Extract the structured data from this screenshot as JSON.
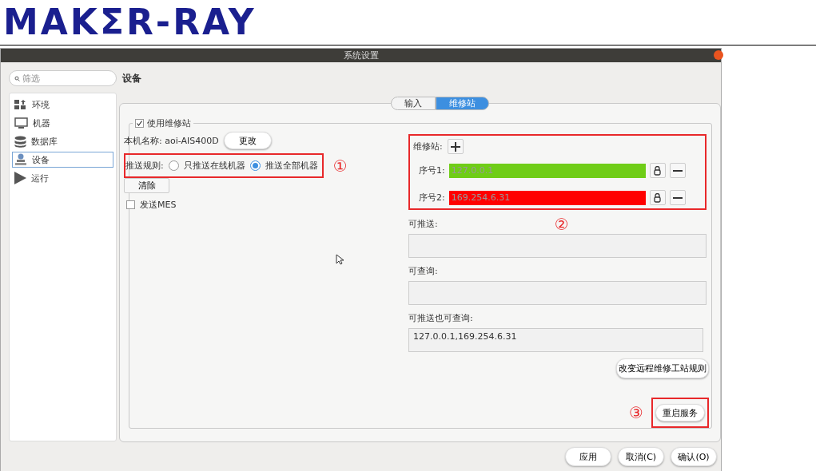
{
  "logo": "MAKΣR-RAY",
  "window": {
    "title": "系统设置"
  },
  "sidebar": {
    "filter_placeholder": "筛选",
    "items": [
      {
        "label": "环境",
        "kind": "environment",
        "selected": false
      },
      {
        "label": "机器",
        "kind": "machine",
        "selected": false
      },
      {
        "label": "数据库",
        "kind": "database",
        "selected": false
      },
      {
        "label": "设备",
        "kind": "device",
        "selected": true
      },
      {
        "label": "运行",
        "kind": "run",
        "selected": false
      }
    ]
  },
  "page_title": "设备",
  "tabs": [
    {
      "label": "输入",
      "selected": false
    },
    {
      "label": "维修站",
      "selected": true
    }
  ],
  "group": {
    "title": "使用维修站",
    "checked": true,
    "host_label": "本机名称:",
    "host_value": "aoi-AIS400D",
    "change_button": "更改",
    "rule_label": "推送规则:",
    "rule_options": [
      {
        "label": "只推送在线机器",
        "selected": false
      },
      {
        "label": "推送全部机器",
        "selected": true
      }
    ],
    "clear_button": "清除",
    "send_mes": {
      "label": "发送MES",
      "checked": false
    }
  },
  "stations": {
    "label": "维修站:",
    "rows": [
      {
        "label": "序号1:",
        "value": "127.0.0.1",
        "color": "#6fcd17"
      },
      {
        "label": "序号2:",
        "value": "169.254.6.31",
        "color": "#ff0000"
      }
    ]
  },
  "lists": [
    {
      "label": "可推送:"
    },
    {
      "label": "可查询:"
    },
    {
      "label": "可推送也可查询:",
      "value": "127.0.0.1,169.254.6.31"
    }
  ],
  "rule_button": "改变远程维修工站规则",
  "restart_button": "重启服务",
  "footer_buttons": [
    "应用",
    "取消(C)",
    "确认(O)"
  ],
  "annotations": [
    "①",
    "②",
    "③"
  ]
}
